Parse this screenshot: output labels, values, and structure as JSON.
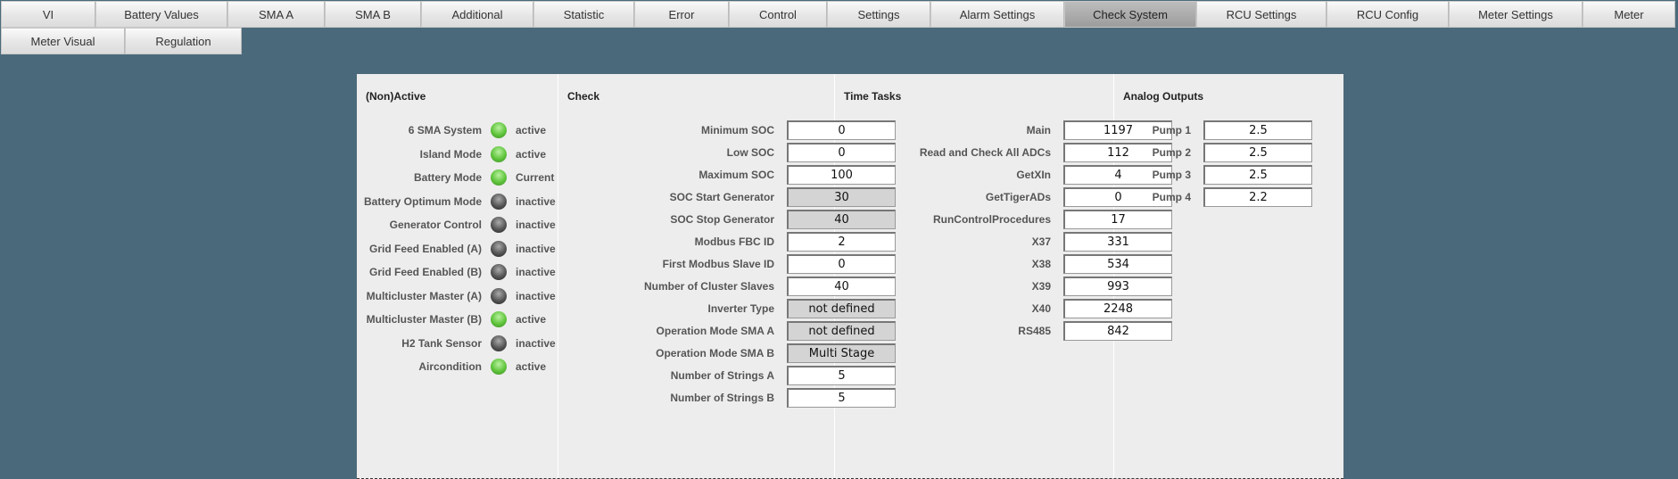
{
  "tabs": [
    {
      "label": "VI",
      "w": 106
    },
    {
      "label": "Battery Values",
      "w": 148
    },
    {
      "label": "SMA A",
      "w": 109
    },
    {
      "label": "SMA B",
      "w": 108
    },
    {
      "label": "Additional",
      "w": 126
    },
    {
      "label": "Statistic",
      "w": 113
    },
    {
      "label": "Error",
      "w": 106
    },
    {
      "label": "Control",
      "w": 110
    },
    {
      "label": "Settings",
      "w": 116
    },
    {
      "label": "Alarm Settings",
      "w": 150
    },
    {
      "label": "Check System",
      "w": 148,
      "selected": true
    },
    {
      "label": "RCU Settings",
      "w": 146
    },
    {
      "label": "RCU Config",
      "w": 137
    },
    {
      "label": "Meter Settings",
      "w": 150
    },
    {
      "label": "Meter",
      "w": 104
    },
    {
      "label": "Meter Visual",
      "w": 139
    },
    {
      "label": "Regulation",
      "w": 131
    }
  ],
  "nonactive": {
    "title": "(Non)Active",
    "items": [
      {
        "label": "6 SMA System",
        "on": true,
        "status": "active"
      },
      {
        "label": "Island Mode",
        "on": true,
        "status": "active"
      },
      {
        "label": "Battery Mode",
        "on": true,
        "status": "Current"
      },
      {
        "label": "Battery Optimum Mode",
        "on": false,
        "status": "inactive"
      },
      {
        "label": "Generator Control",
        "on": false,
        "status": "inactive"
      },
      {
        "label": "Grid Feed Enabled (A)",
        "on": false,
        "status": "inactive"
      },
      {
        "label": "Grid Feed Enabled (B)",
        "on": false,
        "status": "inactive"
      },
      {
        "label": "Multicluster Master (A)",
        "on": false,
        "status": "inactive"
      },
      {
        "label": "Multicluster Master (B)",
        "on": true,
        "status": "active"
      },
      {
        "label": "H2 Tank Sensor",
        "on": false,
        "status": "inactive"
      },
      {
        "label": "Aircondition",
        "on": true,
        "status": "active"
      }
    ]
  },
  "check": {
    "title": "Check",
    "items": [
      {
        "label": "Minimum SOC",
        "value": "0"
      },
      {
        "label": "Low SOC",
        "value": "0"
      },
      {
        "label": "Maximum SOC",
        "value": "100"
      },
      {
        "label": "SOC Start Generator",
        "value": "30",
        "readonly": true
      },
      {
        "label": "SOC Stop Generator",
        "value": "40",
        "readonly": true
      },
      {
        "label": "Modbus FBC ID",
        "value": "2"
      },
      {
        "label": "First Modbus Slave ID",
        "value": "0"
      },
      {
        "label": "Number of Cluster Slaves",
        "value": "40"
      },
      {
        "label": "Inverter Type",
        "value": "not defined",
        "readonly": true
      },
      {
        "label": "Operation Mode SMA A",
        "value": "not defined",
        "readonly": true
      },
      {
        "label": "Operation Mode SMA B",
        "value": "Multi Stage",
        "readonly": true
      },
      {
        "label": "Number of Strings A",
        "value": "5"
      },
      {
        "label": "Number of Strings B",
        "value": "5"
      }
    ]
  },
  "time_tasks": {
    "title": "Time Tasks",
    "items": [
      {
        "label": "Main",
        "value": "1197"
      },
      {
        "label": "Read and Check All ADCs",
        "value": "112"
      },
      {
        "label": "GetXIn",
        "value": "4"
      },
      {
        "label": "GetTigerADs",
        "value": "0"
      },
      {
        "label": "RunControlProcedures",
        "value": "17"
      },
      {
        "label": "X37",
        "value": "331"
      },
      {
        "label": "X38",
        "value": "534"
      },
      {
        "label": "X39",
        "value": "993"
      },
      {
        "label": "X40",
        "value": "2248"
      },
      {
        "label": "RS485",
        "value": "842"
      }
    ]
  },
  "analog": {
    "title": "Analog Outputs",
    "items": [
      {
        "label": "Pump 1",
        "value": "2.5"
      },
      {
        "label": "Pump 2",
        "value": "2.5"
      },
      {
        "label": "Pump 3",
        "value": "2.5"
      },
      {
        "label": "Pump 4",
        "value": "2.2"
      }
    ]
  }
}
